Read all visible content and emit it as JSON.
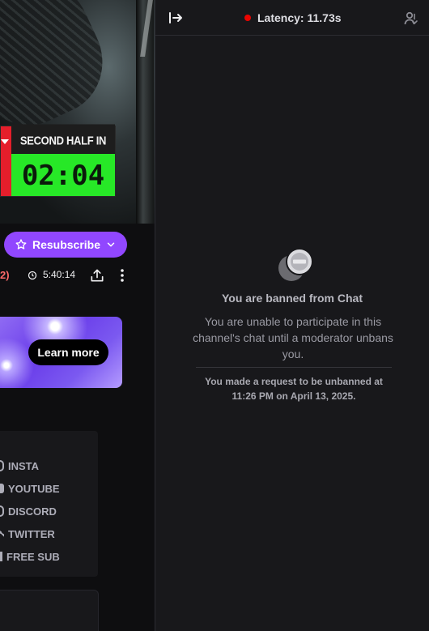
{
  "stream": {
    "scoreboard": {
      "label": "SECOND HALF IN",
      "time": "02:04"
    },
    "resubscribe_label": "Resubscribe",
    "count_text": "2)",
    "uptime": "5:40:14",
    "promo": {
      "button_label": "Learn more"
    },
    "panel_links": [
      "INSTA",
      "YOUTUBE",
      "DISCORD",
      "TWITTER",
      "FREE SUB"
    ]
  },
  "chat": {
    "latency": "Latency: 11.73s",
    "ban_title": "You are banned from Chat",
    "ban_description": "You are unable to participate in this channel's chat until a moderator unbans you.",
    "unban_request": "You made a request to be unbanned at 11:26 PM on April 13, 2025."
  },
  "colors": {
    "brand_purple": "#9147ff",
    "latency_dot": "#eb0400",
    "score_green": "#27e827",
    "score_red": "#e51e2b"
  },
  "icons": [
    "star-icon",
    "chevron-down-icon",
    "clock-icon",
    "share-icon",
    "more-vertical-icon",
    "collapse-chat-icon",
    "community-icon",
    "banned-icon"
  ]
}
